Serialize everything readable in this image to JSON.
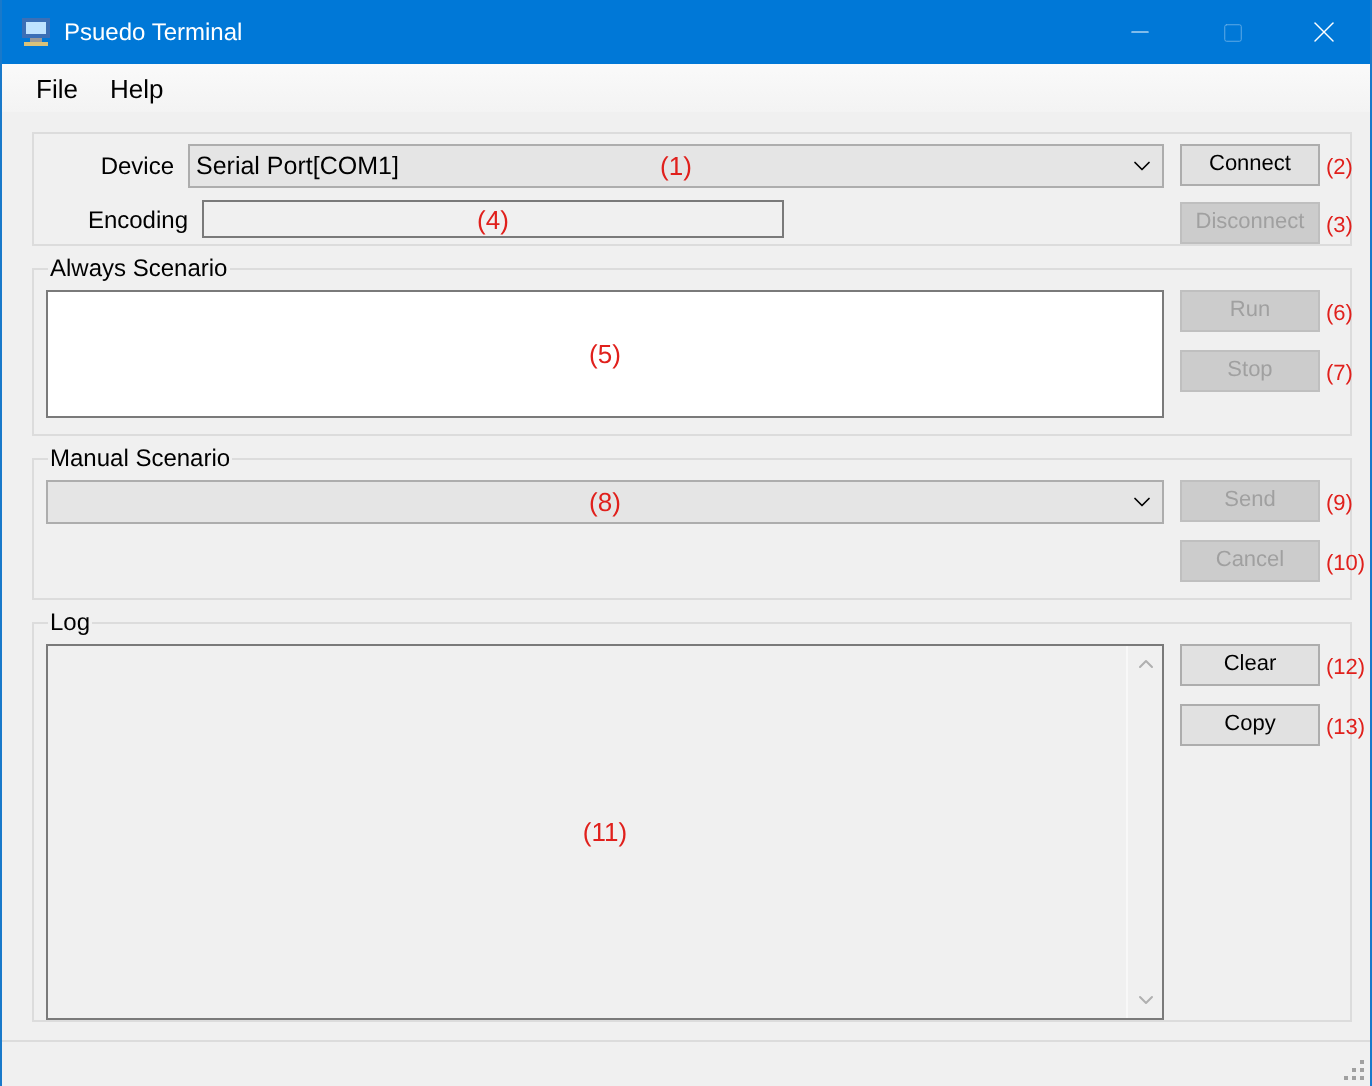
{
  "window": {
    "title": "Psuedo Terminal"
  },
  "menu": [
    {
      "label": "File"
    },
    {
      "label": "Help"
    }
  ],
  "connection": {
    "device": {
      "label": "Device",
      "value": "Serial Port[COM1]",
      "marker": "(1)"
    },
    "encoding": {
      "label": "Encoding",
      "marker": "(4)"
    },
    "buttons": [
      {
        "label": "Connect",
        "disabled": false,
        "marker": "(2)"
      },
      {
        "label": "Disconnect",
        "disabled": true,
        "marker": "(3)"
      }
    ]
  },
  "always_scenario": {
    "title": "Always Scenario",
    "editor_marker": "(5)",
    "buttons": [
      {
        "label": "Run",
        "disabled": true,
        "marker": "(6)"
      },
      {
        "label": "Stop",
        "disabled": true,
        "marker": "(7)"
      }
    ]
  },
  "manual_scenario": {
    "title": "Manual Scenario",
    "dropdown_marker": "(8)",
    "buttons": [
      {
        "label": "Send",
        "disabled": true,
        "marker": "(9)"
      },
      {
        "label": "Cancel",
        "disabled": true,
        "marker": "(10)"
      }
    ]
  },
  "log": {
    "title": "Log",
    "area_marker": "(11)",
    "buttons": [
      {
        "label": "Clear",
        "disabled": false,
        "marker": "(12)"
      },
      {
        "label": "Copy",
        "disabled": false,
        "marker": "(13)"
      }
    ]
  }
}
